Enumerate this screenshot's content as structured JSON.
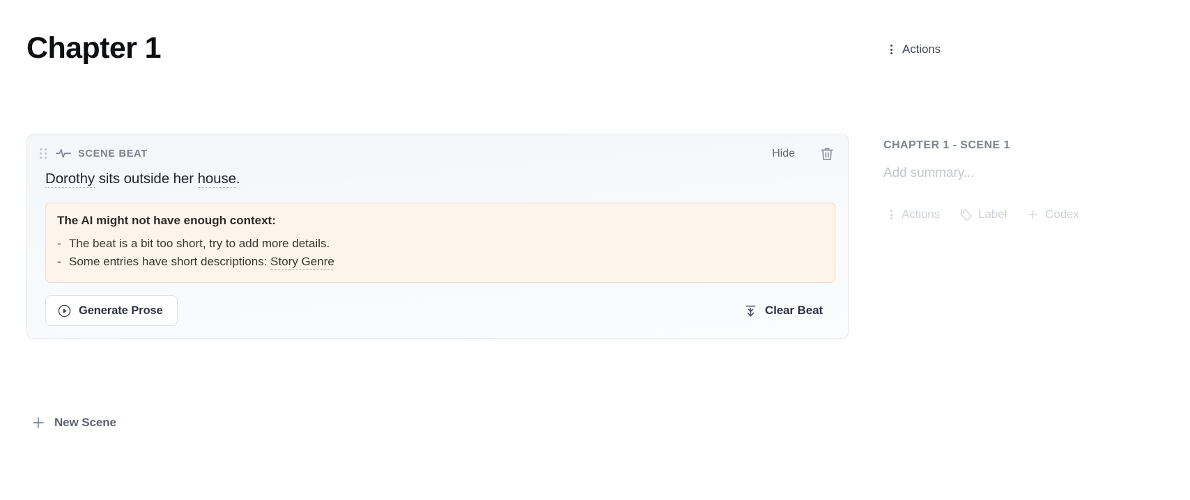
{
  "page": {
    "title": "Chapter 1"
  },
  "beat_card": {
    "drag_handle_icon": "drag-dots-icon",
    "type_icon": "pulse-activity-icon",
    "type_label": "SCENE BEAT",
    "hide_label": "Hide",
    "delete_icon": "trash-icon",
    "text_parts": [
      {
        "text": "Dorothy",
        "entity": true
      },
      {
        "text": " sits outside her ",
        "entity": false
      },
      {
        "text": "house",
        "entity": true
      },
      {
        "text": ".",
        "entity": false
      }
    ],
    "warning": {
      "title": "The AI might not have enough context:",
      "items": [
        {
          "dash": "-",
          "text": "The beat is a bit too short, try to add more details.",
          "link": ""
        },
        {
          "dash": "-",
          "text": "Some entries have short descriptions: ",
          "link": "Story Genre"
        }
      ]
    },
    "generate_button": {
      "label": "Generate Prose",
      "icon": "play-circle-icon"
    },
    "clear_button": {
      "label": "Clear Beat",
      "icon": "collapse-arrow-down-icon"
    }
  },
  "new_scene": {
    "label": "New Scene",
    "icon": "plus-icon"
  },
  "sidebar": {
    "top_actions": {
      "label": "Actions",
      "icon": "dots-vertical-icon"
    },
    "scene_label": "CHAPTER 1 - SCENE 1",
    "summary_placeholder": "Add summary...",
    "tools": [
      {
        "label": "Actions",
        "icon": "dots-vertical-icon"
      },
      {
        "label": "Label",
        "icon": "tag-icon"
      },
      {
        "label": "Codex",
        "icon": "plus-icon"
      }
    ]
  },
  "colors": {
    "page_background": "#ffffff",
    "card_background": "#f5f8fb",
    "card_border": "#e3e7ec",
    "warning_background": "#fdf5eb",
    "warning_border": "#f0d9c4",
    "title_text": "#0d0f13",
    "muted_text": "#78838f",
    "placeholder_text": "#c2c7ce"
  }
}
